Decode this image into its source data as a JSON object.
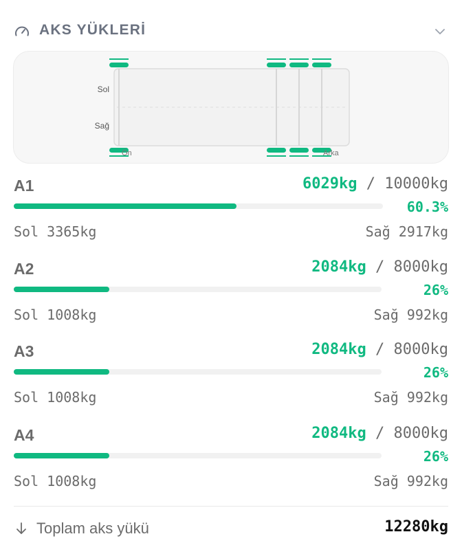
{
  "header": {
    "title": "AKS YÜKLERİ",
    "left_icon": "gauge-icon",
    "right_icon": "chevron-down-icon"
  },
  "diagram": {
    "row_labels": {
      "left": "Sol",
      "right": "Sağ"
    },
    "end_labels": {
      "front": "Ön",
      "rear": "Arka"
    },
    "accent": "#10b981"
  },
  "axles": [
    {
      "name": "A1",
      "current": "6029kg",
      "separator": "/",
      "limit": "10000kg",
      "percent": "60.3%",
      "ratio": 0.603,
      "left": "Sol 3365kg",
      "right": "Sağ 2917kg"
    },
    {
      "name": "A2",
      "current": "2084kg",
      "separator": "/",
      "limit": "8000kg",
      "percent": "26%",
      "ratio": 0.26,
      "left": "Sol 1008kg",
      "right": "Sağ 992kg"
    },
    {
      "name": "A3",
      "current": "2084kg",
      "separator": "/",
      "limit": "8000kg",
      "percent": "26%",
      "ratio": 0.26,
      "left": "Sol 1008kg",
      "right": "Sağ 992kg"
    },
    {
      "name": "A4",
      "current": "2084kg",
      "separator": "/",
      "limit": "8000kg",
      "percent": "26%",
      "ratio": 0.26,
      "left": "Sol 1008kg",
      "right": "Sağ 992kg"
    }
  ],
  "total": {
    "icon": "arrow-down-icon",
    "label": "Toplam aks yükü",
    "value": "12280kg"
  }
}
